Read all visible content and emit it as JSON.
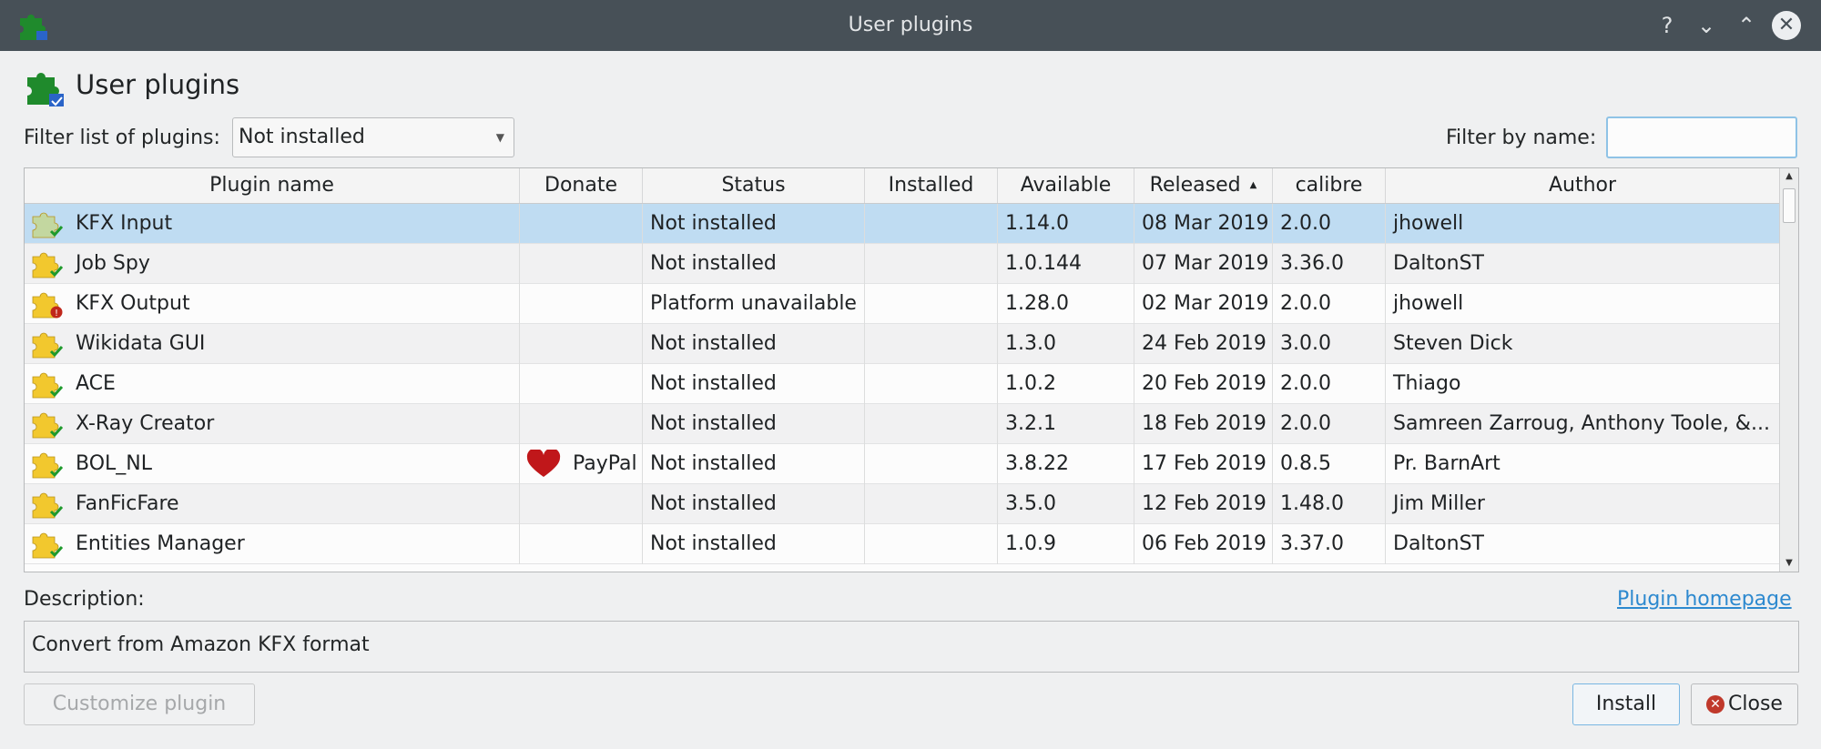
{
  "window": {
    "title": "User plugins",
    "controls": [
      "?",
      "⌄",
      "⌃",
      "✕"
    ]
  },
  "header": {
    "title": "User plugins"
  },
  "filter": {
    "label": "Filter list of plugins:",
    "selected": "Not installed",
    "name_label": "Filter by name:",
    "name_value": ""
  },
  "table": {
    "columns": [
      "Plugin name",
      "Donate",
      "Status",
      "Installed",
      "Available",
      "Released",
      "calibre",
      "Author"
    ],
    "sorted_column": "Released",
    "rows": [
      {
        "name": "KFX Input",
        "donate": "",
        "status": "Not installed",
        "installed": "",
        "available": "1.14.0",
        "released": "08 Mar 2019",
        "calibre": "2.0.0",
        "author": "jhowell",
        "icon": "plugin-ok-icon",
        "selected": true
      },
      {
        "name": "Job Spy",
        "donate": "",
        "status": "Not installed",
        "installed": "",
        "available": "1.0.144",
        "released": "07 Mar 2019",
        "calibre": "3.36.0",
        "author": "DaltonST",
        "icon": "plugin-ok-icon"
      },
      {
        "name": "KFX Output",
        "donate": "",
        "status": "Platform unavailable",
        "installed": "",
        "available": "1.28.0",
        "released": "02 Mar 2019",
        "calibre": "2.0.0",
        "author": "jhowell",
        "icon": "plugin-error-icon"
      },
      {
        "name": "Wikidata GUI",
        "donate": "",
        "status": "Not installed",
        "installed": "",
        "available": "1.3.0",
        "released": "24 Feb 2019",
        "calibre": "3.0.0",
        "author": "Steven Dick",
        "icon": "plugin-ok-icon"
      },
      {
        "name": "ACE",
        "donate": "",
        "status": "Not installed",
        "installed": "",
        "available": "1.0.2",
        "released": "20 Feb 2019",
        "calibre": "2.0.0",
        "author": "Thiago",
        "icon": "plugin-ok-icon"
      },
      {
        "name": "X-Ray Creator",
        "donate": "",
        "status": "Not installed",
        "installed": "",
        "available": "3.2.1",
        "released": "18 Feb 2019",
        "calibre": "2.0.0",
        "author": "Samreen Zarroug, Anthony Toole, &...",
        "icon": "plugin-ok-icon"
      },
      {
        "name": "BOL_NL",
        "donate": "PayPal",
        "status": "Not installed",
        "installed": "",
        "available": "3.8.22",
        "released": "17 Feb 2019",
        "calibre": "0.8.5",
        "author": "Pr. BarnArt",
        "icon": "plugin-ok-icon"
      },
      {
        "name": "FanFicFare",
        "donate": "",
        "status": "Not installed",
        "installed": "",
        "available": "3.5.0",
        "released": "12 Feb 2019",
        "calibre": "1.48.0",
        "author": "Jim Miller",
        "icon": "plugin-ok-icon"
      },
      {
        "name": "Entities Manager",
        "donate": "",
        "status": "Not installed",
        "installed": "",
        "available": "1.0.9",
        "released": "06 Feb 2019",
        "calibre": "3.37.0",
        "author": "DaltonST",
        "icon": "plugin-ok-icon"
      }
    ]
  },
  "description": {
    "label": "Description:",
    "homepage_link": "Plugin homepage",
    "text": "Convert from Amazon KFX format"
  },
  "buttons": {
    "customize": "Customize plugin",
    "install": "Install",
    "close": "Close"
  },
  "colors": {
    "titlebar": "#475057",
    "selection": "#bfdcf2",
    "link": "#2d89cf",
    "puzzle_green": "#1f8a2c",
    "puzzle_yellow": "#f2c82e"
  }
}
